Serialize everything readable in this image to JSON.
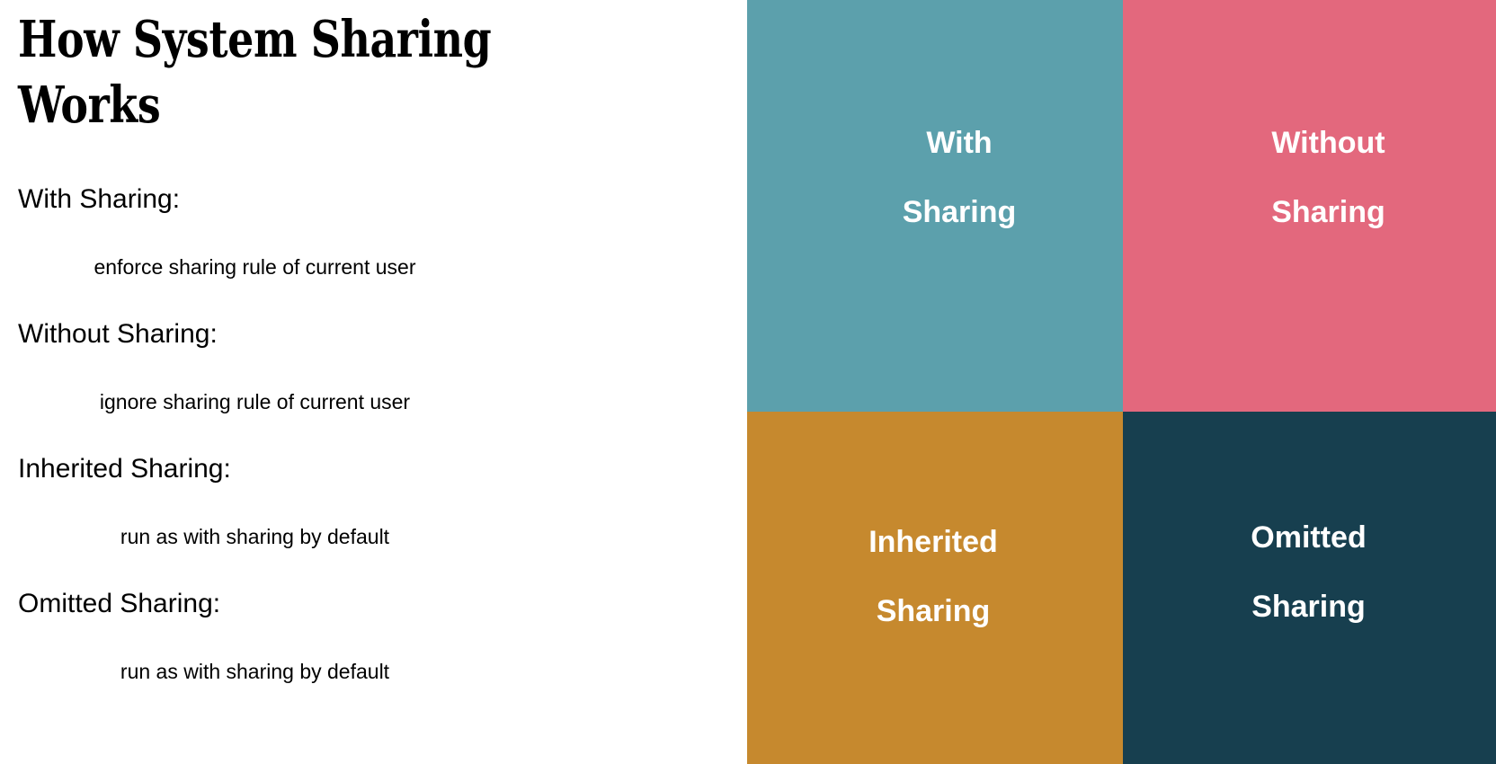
{
  "slide": {
    "title": "How System Sharing Works",
    "background_color": "#ffffff"
  },
  "bullets": [
    {
      "heading": "With Sharing:",
      "detail": "enforce sharing rule of current user"
    },
    {
      "heading": "Without Sharing:",
      "detail": "ignore sharing rule of current user"
    },
    {
      "heading": "Inherited Sharing:",
      "detail": "run as with sharing by default"
    },
    {
      "heading": "Omitted Sharing:",
      "detail": "run as with sharing by default"
    }
  ],
  "quadrants": [
    {
      "id": "with-sharing",
      "line1": "With",
      "line2": "Sharing",
      "color": "#5CA0AC",
      "text_color": "#ffffff"
    },
    {
      "id": "without-sharing",
      "line1": "Without",
      "line2": "Sharing",
      "color": "#E3687D",
      "text_color": "#ffffff"
    },
    {
      "id": "inherited-sharing",
      "line1": "Inherited",
      "line2": "Sharing",
      "color": "#C6892E",
      "text_color": "#ffffff"
    },
    {
      "id": "omitted-sharing",
      "line1": "Omitted",
      "line2": "Sharing",
      "color": "#173F4F",
      "text_color": "#ffffff"
    }
  ]
}
